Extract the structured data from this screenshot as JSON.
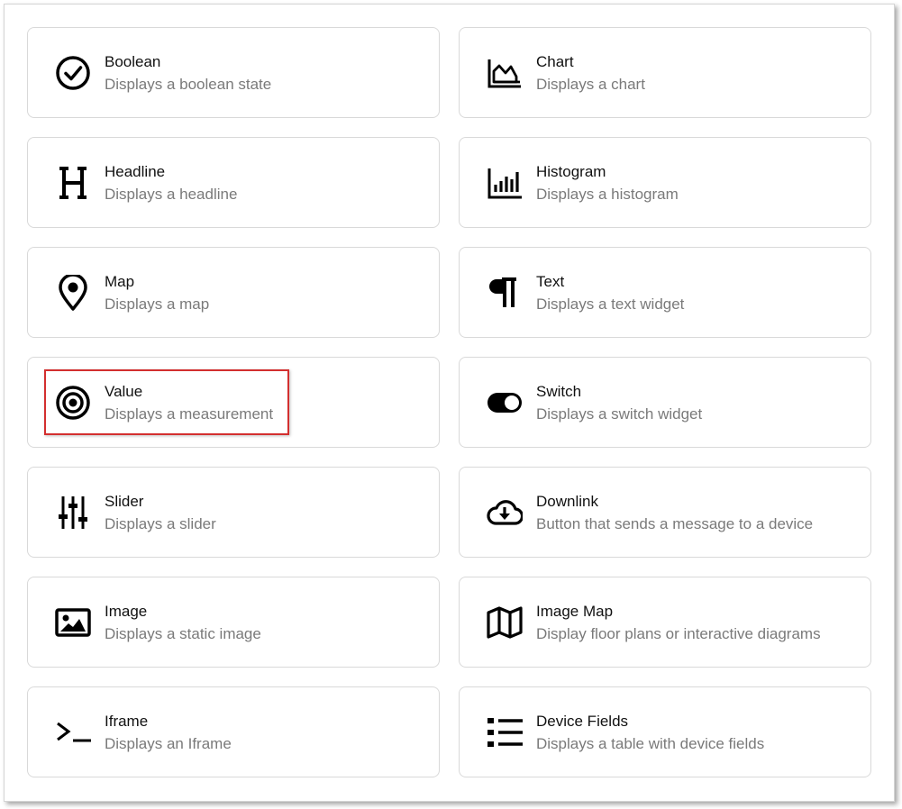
{
  "widgets": [
    {
      "title": "Boolean",
      "description": "Displays a boolean state",
      "icon": "check-circle-icon"
    },
    {
      "title": "Chart",
      "description": "Displays a chart",
      "icon": "area-chart-icon"
    },
    {
      "title": "Headline",
      "description": "Displays a headline",
      "icon": "headline-h-icon"
    },
    {
      "title": "Histogram",
      "description": "Displays a histogram",
      "icon": "histogram-icon"
    },
    {
      "title": "Map",
      "description": "Displays a map",
      "icon": "map-pin-icon"
    },
    {
      "title": "Text",
      "description": "Displays a text widget",
      "icon": "pilcrow-icon"
    },
    {
      "title": "Value",
      "description": "Displays a measurement",
      "icon": "target-icon"
    },
    {
      "title": "Switch",
      "description": "Displays a switch widget",
      "icon": "toggle-switch-icon"
    },
    {
      "title": "Slider",
      "description": "Displays a slider",
      "icon": "sliders-icon"
    },
    {
      "title": "Downlink",
      "description": "Button that sends a message to a device",
      "icon": "cloud-download-icon"
    },
    {
      "title": "Image",
      "description": "Displays a static image",
      "icon": "image-icon"
    },
    {
      "title": "Image Map",
      "description": "Display floor plans or interactive diagrams",
      "icon": "folded-map-icon"
    },
    {
      "title": "Iframe",
      "description": "Displays an Iframe",
      "icon": "terminal-prompt-icon"
    },
    {
      "title": "Device Fields",
      "description": "Displays a table with device fields",
      "icon": "list-icon"
    }
  ],
  "highlighted_widget": "Value",
  "colors": {
    "card_border": "#d9d9d9",
    "title_text": "#111111",
    "description_text": "#7a7a7a",
    "highlight_border": "#d32f2f",
    "icon": "#000000"
  }
}
